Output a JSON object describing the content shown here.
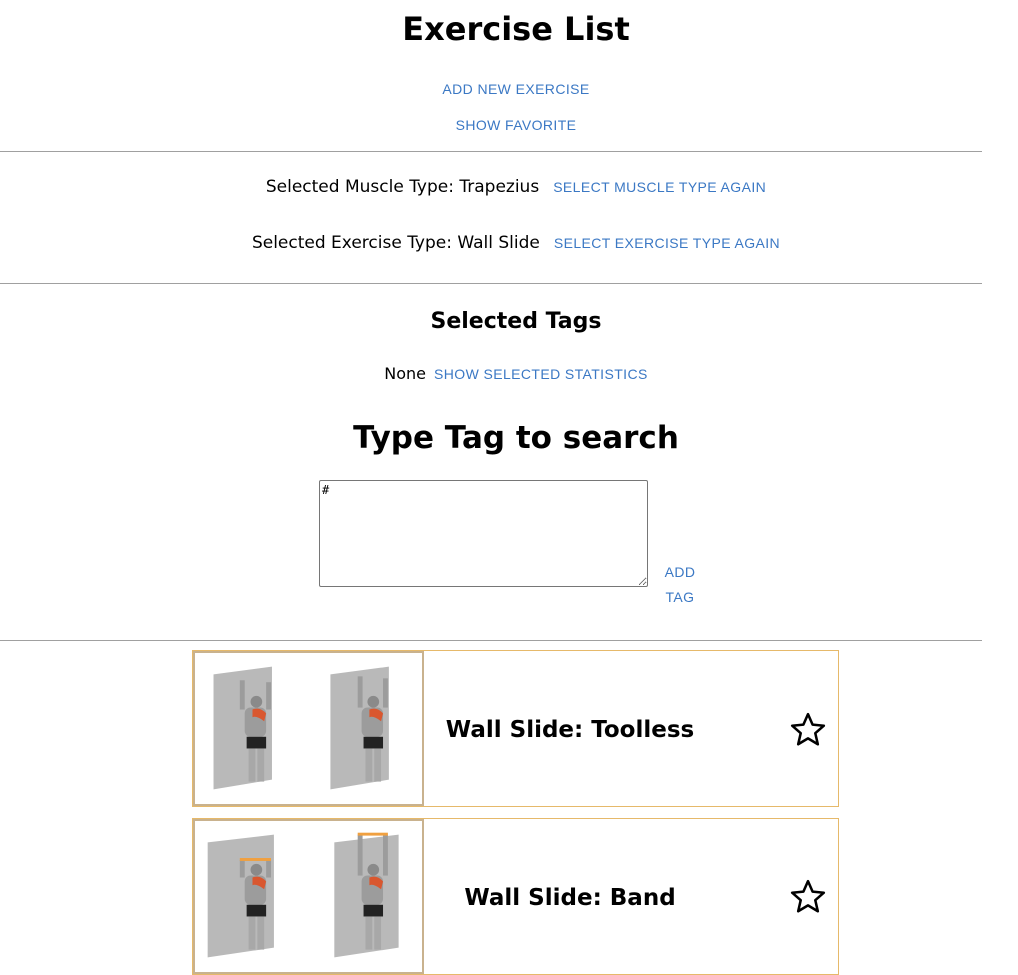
{
  "header": {
    "title": "Exercise List",
    "add_new_exercise": "ADD NEW EXERCISE",
    "show_favorite": "SHOW FAVORITE"
  },
  "selection": {
    "muscle_label": "Selected Muscle Type: Trapezius",
    "muscle_again": "SELECT MUSCLE TYPE AGAIN",
    "exercise_label": "Selected Exercise Type: Wall Slide",
    "exercise_again": "SELECT EXERCISE TYPE AGAIN"
  },
  "tags": {
    "title": "Selected Tags",
    "none_text": "None",
    "show_stats": "SHOW SELECTED STATISTICS"
  },
  "search": {
    "title": "Type Tag to search",
    "input_value": "#",
    "add_tag_line1": "ADD",
    "add_tag_line2": "TAG"
  },
  "cards": [
    {
      "name": "Wall Slide: Toolless",
      "favorite_icon": "star-outline-icon",
      "image": "wall-slide-toolless-illustration"
    },
    {
      "name": "Wall Slide: Band",
      "favorite_icon": "star-outline-icon",
      "image": "wall-slide-band-illustration"
    }
  ],
  "colors": {
    "link": "#3b78c4",
    "divider": "#a0a0a0",
    "card_border": "#e6b96a",
    "muscle_highlight": "#d9572f",
    "band": "#f0a040"
  }
}
